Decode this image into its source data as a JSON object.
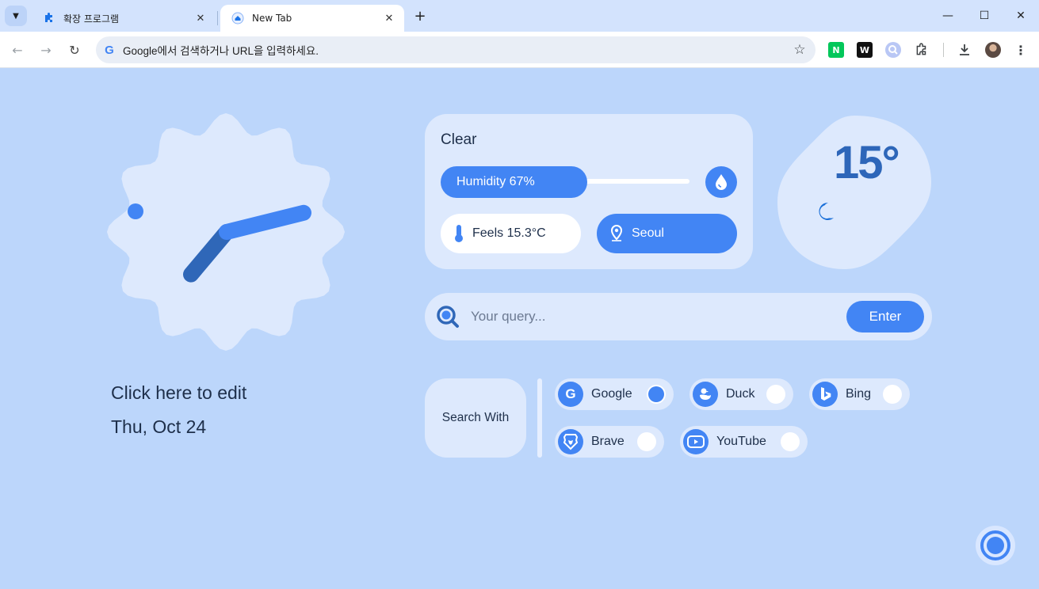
{
  "browser": {
    "tabs": [
      {
        "title": "확장 프로그램",
        "icon": "puzzle-icon",
        "active": false
      },
      {
        "title": "New Tab",
        "icon": "home-icon",
        "active": true
      }
    ],
    "omnibox_placeholder": "Google에서 검색하거나 URL을 입력하세요.",
    "extensions": [
      "naver-n-icon",
      "w-extension-icon",
      "lens-icon",
      "puzzle-icon"
    ],
    "accent": "#d3e3fd"
  },
  "clock": {
    "hour_hand_deg": 220,
    "minute_hand_deg": 76
  },
  "date_block": {
    "edit_label": "Click here to edit",
    "date": "Thu, Oct 24"
  },
  "weather": {
    "condition": "Clear",
    "humidity_label": "Humidity 67%",
    "humidity_fraction": 0.67,
    "feels_label": "Feels 15.3°C",
    "location": "Seoul",
    "temperature": "15°",
    "icon": "moon-icon"
  },
  "search": {
    "placeholder": "Your query...",
    "enter_label": "Enter"
  },
  "search_with": {
    "label": "Search With",
    "engines": [
      {
        "name": "Google",
        "icon": "google-icon",
        "selected": true
      },
      {
        "name": "Duck",
        "icon": "duck-icon",
        "selected": false
      },
      {
        "name": "Bing",
        "icon": "bing-icon",
        "selected": false
      },
      {
        "name": "Brave",
        "icon": "brave-icon",
        "selected": false
      },
      {
        "name": "YouTube",
        "icon": "youtube-icon",
        "selected": false
      }
    ]
  },
  "colors": {
    "background": "#bcd6fb",
    "card": "#dde9fd",
    "accent": "#4285f4",
    "temp_text": "#2d66b9"
  }
}
